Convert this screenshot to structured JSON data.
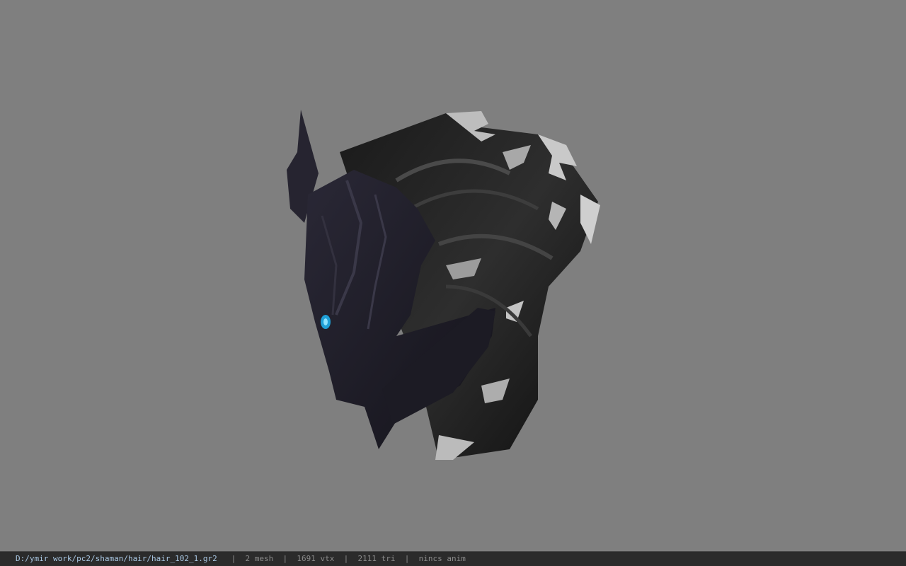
{
  "viewport": {
    "background": "#7f7f7f",
    "model_name": "hair_102_1"
  },
  "statusbar": {
    "path": "D:/ymir work/pc2/shaman/hair/hair_102_1.gr2",
    "separator": "|",
    "mesh": "2 mesh",
    "vtx": "1691 vtx",
    "tri": "2111 tri",
    "anim": "nincs anim"
  }
}
